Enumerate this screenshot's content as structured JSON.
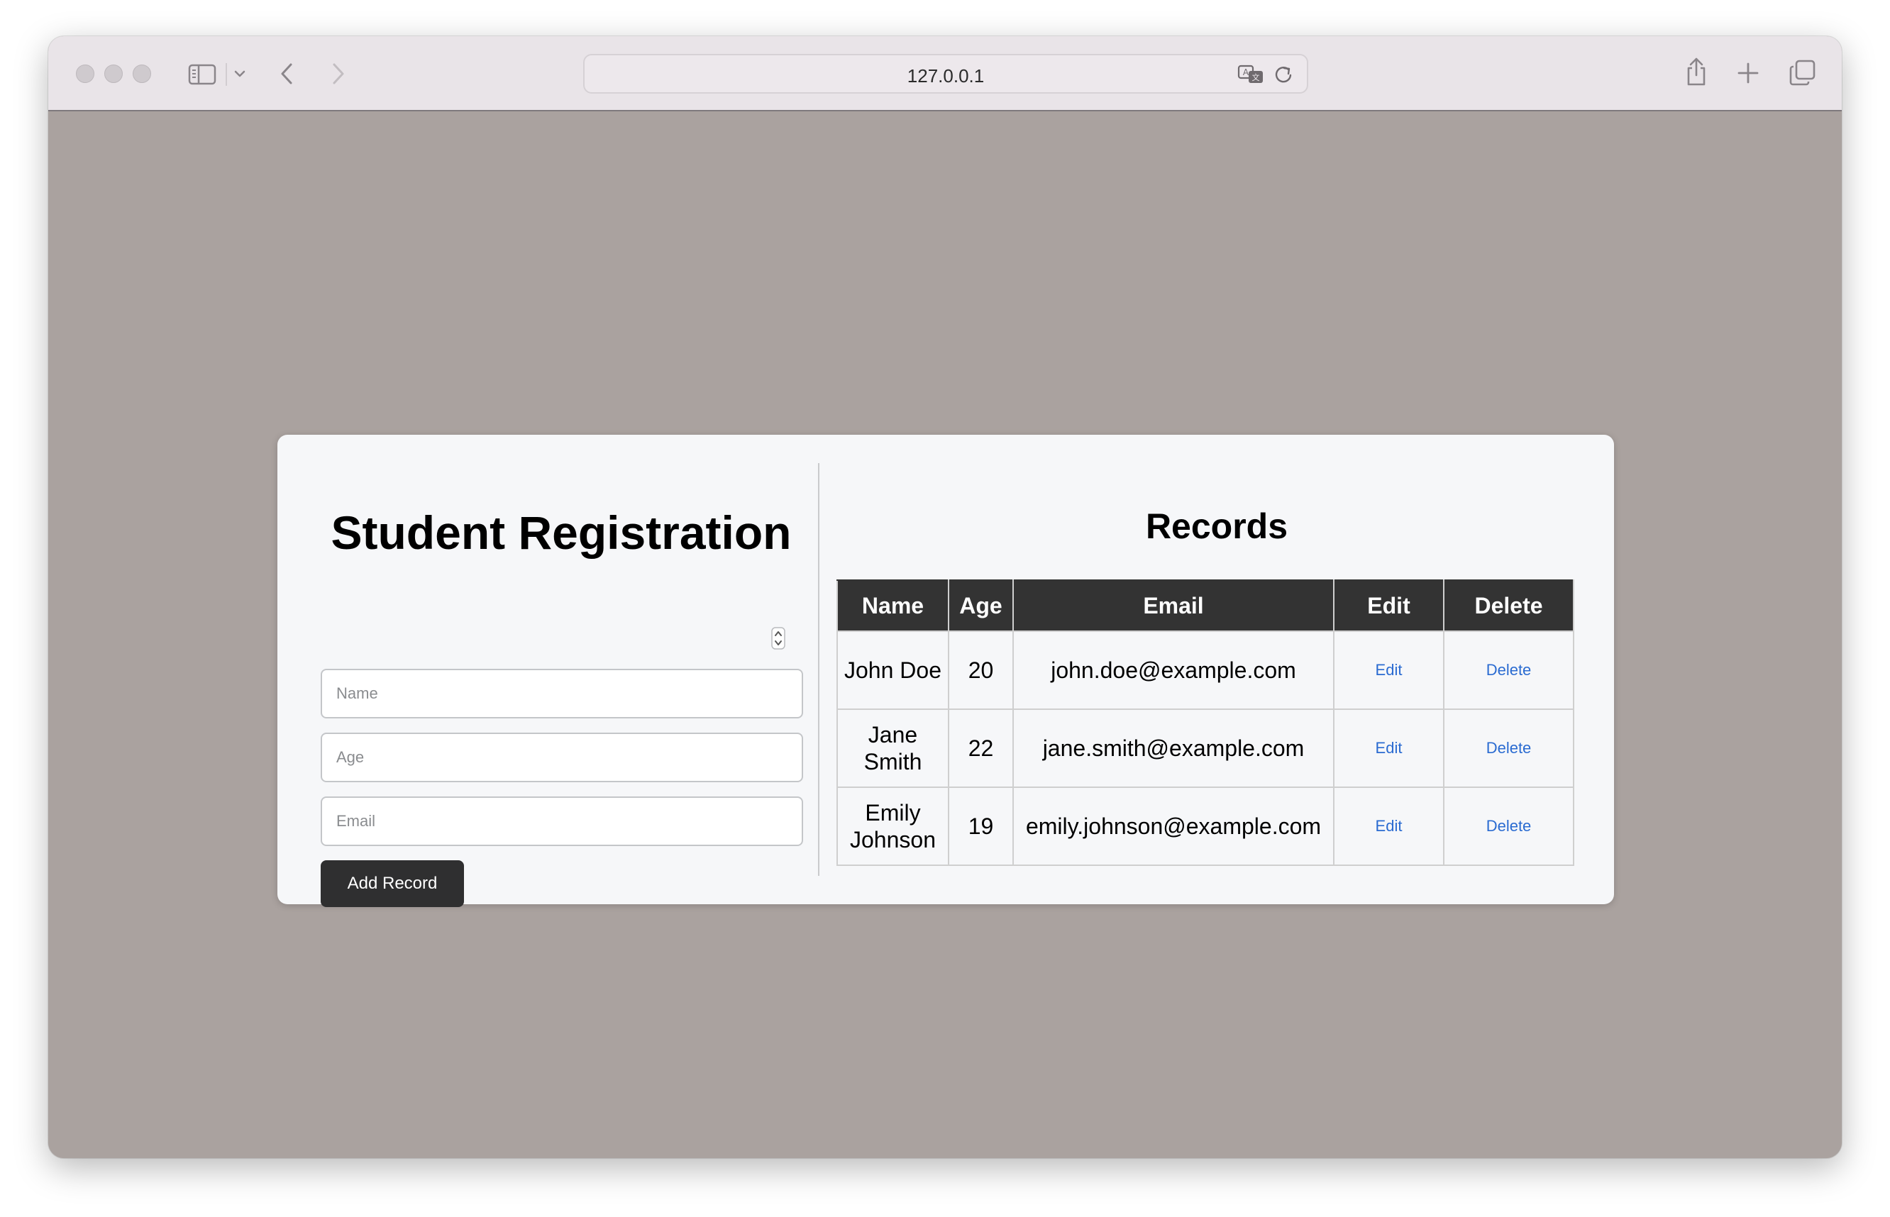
{
  "browser": {
    "url": "127.0.0.1"
  },
  "form": {
    "title": "Student Registration",
    "name_placeholder": "Name",
    "age_placeholder": "Age",
    "email_placeholder": "Email",
    "submit_label": "Add Record"
  },
  "records": {
    "title": "Records",
    "columns": [
      "Name",
      "Age",
      "Email",
      "Edit",
      "Delete"
    ],
    "rows": [
      {
        "name": "John Doe",
        "age": "20",
        "email": "john.doe@example.com",
        "edit": "Edit",
        "delete": "Delete"
      },
      {
        "name": "Jane Smith",
        "age": "22",
        "email": "jane.smith@example.com",
        "edit": "Edit",
        "delete": "Delete"
      },
      {
        "name": "Emily Johnson",
        "age": "19",
        "email": "emily.johnson@example.com",
        "edit": "Edit",
        "delete": "Delete"
      }
    ]
  },
  "colors": {
    "page_background": "#aaa29f",
    "card_background": "#f6f7f9",
    "table_header": "#333333",
    "button": "#2f2f30",
    "link": "#2a6bd1"
  },
  "icons": {
    "toolbar": [
      "sidebar-icon",
      "chevron-down-icon",
      "back-icon",
      "forward-icon",
      "translate-icon",
      "reload-icon",
      "share-icon",
      "new-tab-icon",
      "tabs-overview-icon"
    ],
    "field": [
      "number-stepper-icon"
    ]
  }
}
